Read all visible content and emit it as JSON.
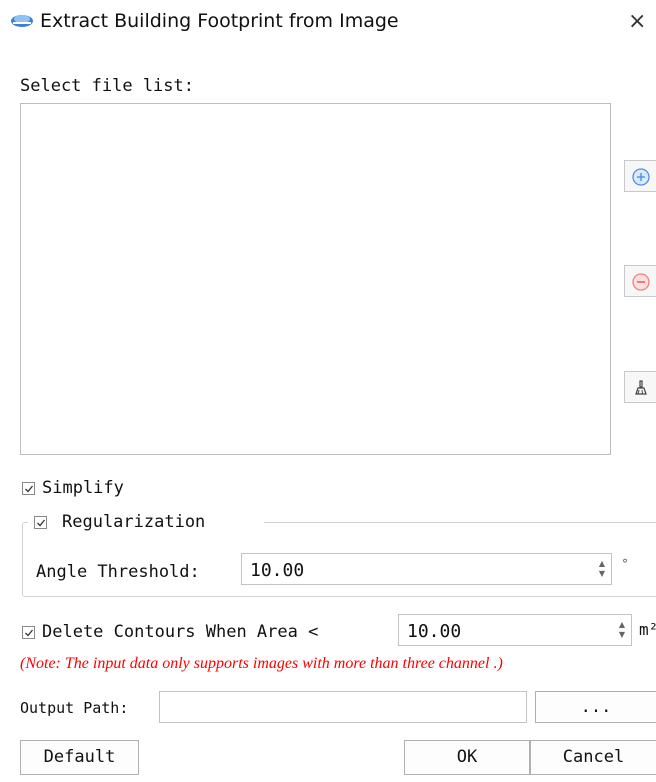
{
  "window": {
    "title": "Extract Building Footprint from Image",
    "close_glyph": "×"
  },
  "file_list": {
    "label": "Select file list:",
    "items": []
  },
  "side_buttons": [
    {
      "icon": "add-icon",
      "color": "#4a8fe8"
    },
    {
      "icon": "remove-icon",
      "color": "#f08080"
    },
    {
      "icon": "clear-brush-icon",
      "color": "#444444"
    }
  ],
  "simplify": {
    "label": "Simplify",
    "checked": true
  },
  "regularization": {
    "label": "Regularization",
    "checked": true,
    "angle_label": "Angle Threshold:",
    "angle_value": "10.00",
    "angle_unit": "°"
  },
  "delete_contours": {
    "label": "Delete Contours When Area <",
    "checked": true,
    "value": "10.00",
    "unit": "m²"
  },
  "note": "(Note: The input data only supports images with more than three channel .)",
  "output": {
    "label": "Output Path:",
    "value": "",
    "browse_label": "..."
  },
  "buttons": {
    "default": "Default",
    "ok": "OK",
    "cancel": "Cancel"
  },
  "colors": {
    "note": "#ff0000",
    "accent": "#4a8fe8"
  }
}
